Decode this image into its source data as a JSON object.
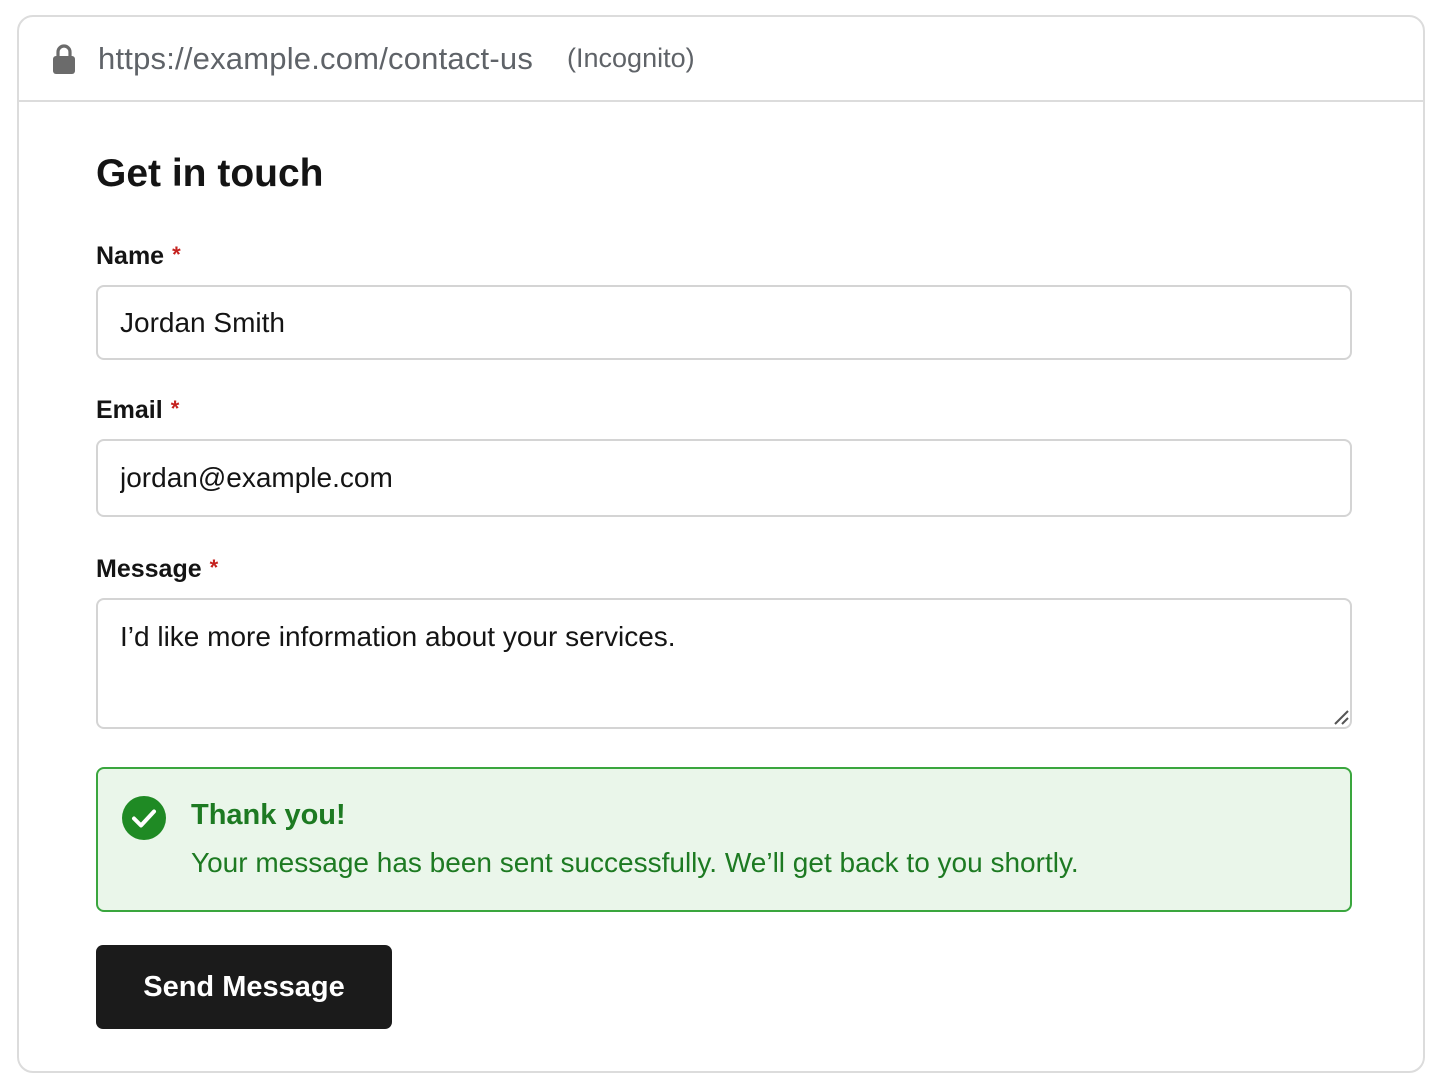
{
  "browser": {
    "url": "https://example.com/contact-us",
    "mode_label": "(Incognito)",
    "lock_icon": "lock-icon"
  },
  "form": {
    "title": "Get in touch",
    "required_marker": "*",
    "fields": {
      "name": {
        "label": "Name",
        "value": "Jordan Smith"
      },
      "email": {
        "label": "Email",
        "value": "jordan@example.com"
      },
      "message": {
        "label": "Message",
        "value": "I’d like more information about your services."
      }
    },
    "success": {
      "icon": "check-circle-icon",
      "title": "Thank you!",
      "message": "Your message has been sent successfully. We’ll get back to you shortly."
    },
    "submit_label": "Send Message"
  },
  "colors": {
    "required": "#c5221f",
    "success_text": "#1d7a22",
    "success_border": "#3aa63e",
    "success_background": "#eaf6ea",
    "button_background": "#1b1b1b"
  }
}
